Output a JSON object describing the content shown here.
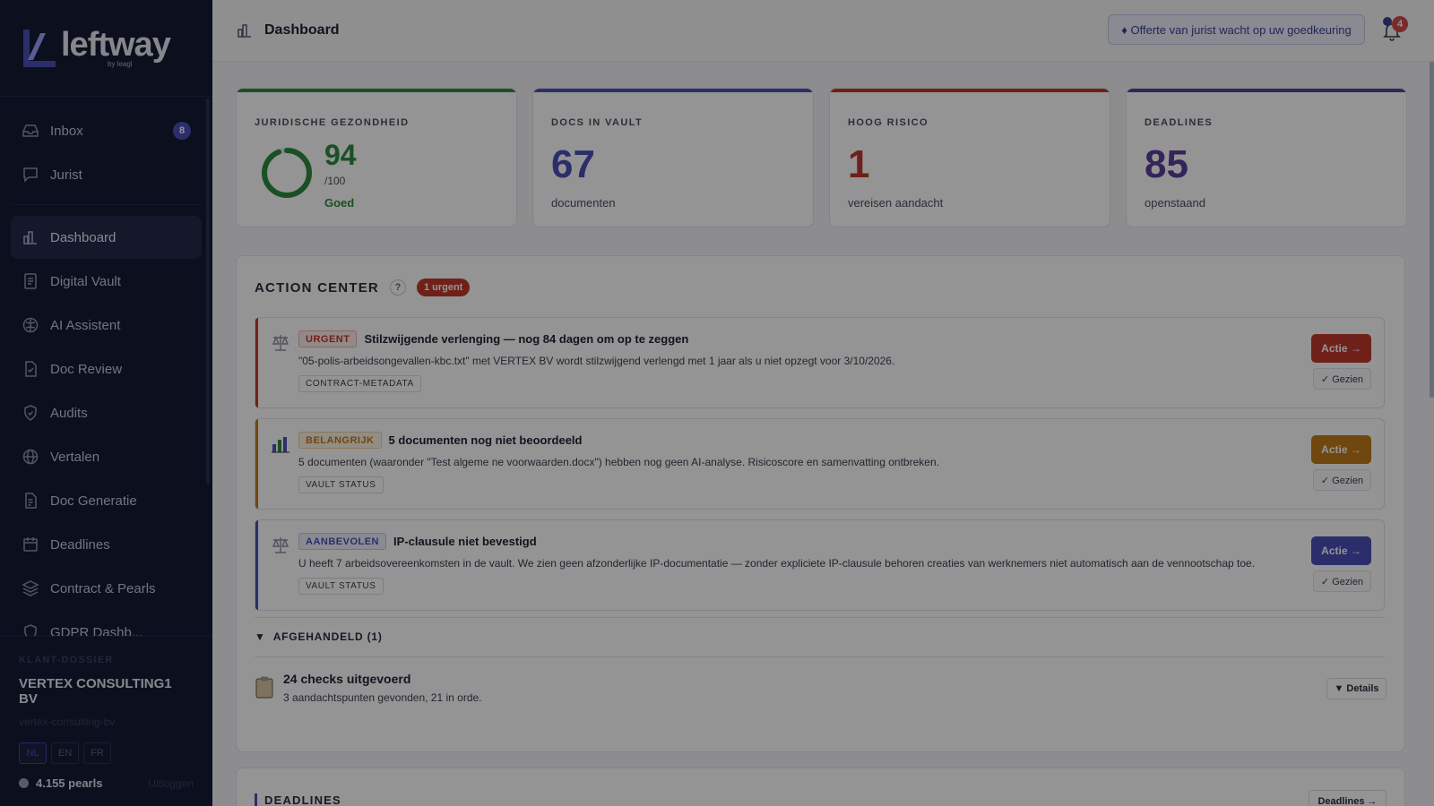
{
  "brand": {
    "name": "leftway",
    "sub": "by leagl"
  },
  "sidebar": {
    "top_items": [
      {
        "label": "Inbox",
        "badge": "8"
      },
      {
        "label": "Jurist"
      }
    ],
    "items": [
      {
        "label": "Dashboard",
        "active": true
      },
      {
        "label": "Digital Vault"
      },
      {
        "label": "AI Assistent"
      },
      {
        "label": "Doc Review"
      },
      {
        "label": "Audits"
      },
      {
        "label": "Vertalen"
      },
      {
        "label": "Doc Generatie"
      },
      {
        "label": "Deadlines"
      },
      {
        "label": "Contract & Pearls"
      },
      {
        "label": "GDPR Dashb..."
      }
    ],
    "client": {
      "kicker": "KLANT-DOSSIER",
      "name": "VERTEX CONSULTING1 BV",
      "slug": "vertex-consulting-bv",
      "languages": [
        "NL",
        "EN",
        "FR"
      ],
      "active_language": "NL",
      "pearls": "4.155 pearls",
      "logout": "Uitloggen"
    }
  },
  "topbar": {
    "title": "Dashboard",
    "offer": "♦ Offerte van jurist wacht op uw goedkeuring",
    "notification_count": "4"
  },
  "stats": {
    "health": {
      "kicker": "JURIDISCHE GEZONDHEID",
      "value": "94",
      "of": "/100",
      "label": "Goed",
      "score_fraction": 0.94
    },
    "docs": {
      "kicker": "DOCS IN VAULT",
      "value": "67",
      "sub": "documenten"
    },
    "risk": {
      "kicker": "HOOG RISICO",
      "value": "1",
      "sub": "vereisen aandacht"
    },
    "deadlines": {
      "kicker": "DEADLINES",
      "value": "85",
      "sub": "openstaand"
    }
  },
  "action_center": {
    "title": "ACTION CENTER",
    "help": "?",
    "urgent_badge": "1 urgent",
    "actions": [
      {
        "tag": "URGENT",
        "title": "Stilzwijgende verlenging — nog 84 dagen om op te zeggen",
        "desc": "\"05-polis-arbeidsongevallen-kbc.txt\" met VERTEX BV wordt stilzwijgend verlengd met 1 jaar als u niet opzegt voor 3/10/2026.",
        "chip": "CONTRACT-METADATA",
        "action_label": "Actie →",
        "seen_label": "✓ Gezien"
      },
      {
        "tag": "BELANGRIJK",
        "title": "5 documenten nog niet beoordeeld",
        "desc": "5 documenten (waaronder \"Test algeme ne voorwaarden.docx\") hebben nog geen AI-analyse. Risicoscore en samenvatting ontbreken.",
        "chip": "VAULT STATUS",
        "action_label": "Actie →",
        "seen_label": "✓ Gezien"
      },
      {
        "tag": "AANBEVOLEN",
        "title": "IP-clausule niet bevestigd",
        "desc": "U heeft 7 arbeidsovereenkomsten in de vault. We zien geen afzonderlijke IP-documentatie — zonder expliciete IP-clausule behoren creaties van werknemers niet automatisch aan de vennootschap toe.",
        "chip": "VAULT STATUS",
        "action_label": "Actie →",
        "seen_label": "✓ Gezien"
      }
    ],
    "handled_label": "AFGEHANDELD (1)",
    "checks_title": "24 checks uitgevoerd",
    "checks_sub": "3 aandachtspunten gevonden, 21 in orde.",
    "details_label": "▼ Details"
  },
  "deadlines_panel": {
    "title": "DEADLINES",
    "button": "Deadlines →"
  },
  "colors": {
    "health": "#2f8a3e",
    "docs": "#4a50b8",
    "risk": "#c0392b",
    "deadlines": "#5b3f9c",
    "urgent": "#c0392b",
    "important": "#c27a1a",
    "recommended": "#4a50b8"
  }
}
